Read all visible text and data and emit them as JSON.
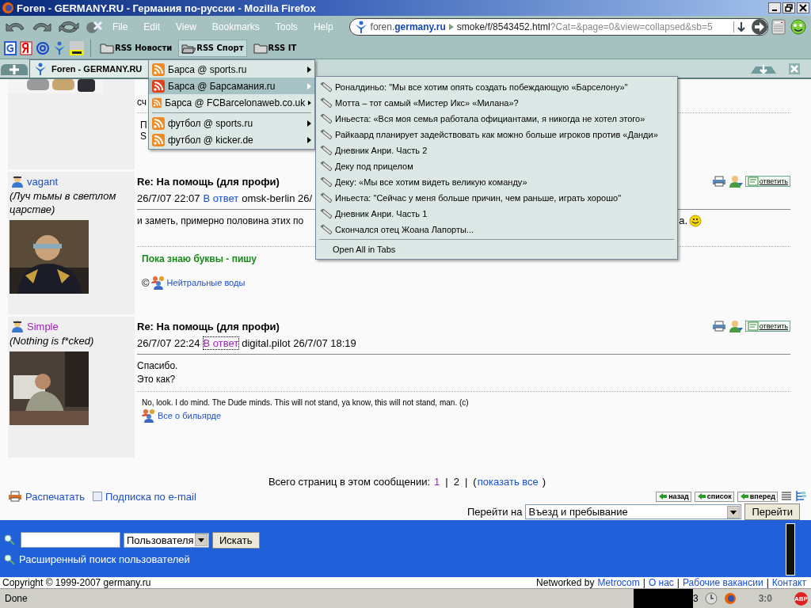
{
  "window": {
    "title": "Foren - GERMANY.RU - Германия по-русски - Mozilla Firefox"
  },
  "menu_bar": [
    "File",
    "Edit",
    "View",
    "Bookmarks",
    "Tools",
    "Help"
  ],
  "address": {
    "subdomain": "foren.",
    "domain": "germany.ru",
    "path": "smoke/f/8543452.html",
    "query": "?Cat=&page=0&view=collapsed&sb=5"
  },
  "bookmarks": [
    {
      "label": "RSS Новости",
      "selected": false
    },
    {
      "label": "RSS Спорт",
      "selected": true
    },
    {
      "label": "RSS IT",
      "selected": false
    }
  ],
  "tab": {
    "title": "Foren - GERMANY.RU"
  },
  "rss_menu": {
    "groups": [
      [
        {
          "label": "Барса @ sports.ru",
          "selected": false
        },
        {
          "label": "Барса @ Барсамания.ru",
          "selected": true
        },
        {
          "label": "Барса @ FCBarcelonaweb.co.uk",
          "selected": false
        }
      ],
      [
        {
          "label": "футбол @ sports.ru",
          "selected": false
        },
        {
          "label": "футбол @ kicker.de",
          "selected": false
        }
      ]
    ]
  },
  "feed_menu": {
    "items": [
      "Роналдиньо: \"Мы все хотим опять создать побеждающую «Барселону»\"",
      "Мотта – тот самый «Мистер Икс» «Милана»?",
      "Иньеста: «Вся моя семья работала официантами, я никогда не хотел этого»",
      "Райкаард планирует задействовать как можно больше игроков против «Данди»",
      "Дневник Анри. Часть 2",
      "Деку под прицелом",
      "Деку: «Мы все хотим видеть великую команду»",
      "Иньеста: \"Сейчас у меня больше причин, чем раньше, играть хорошо\"",
      "Дневник Анри. Часть 1",
      "Скончался отец Жоана Лапорты..."
    ],
    "open_all": "Open All in Tabs"
  },
  "previous_post": {
    "lines": [
      "сч",
      "П",
      "S"
    ]
  },
  "posts": [
    {
      "author": "vagant",
      "author_visited": false,
      "tagline": "(Луч тьмы в светлом царстве)",
      "title": "Re: На помощь (для профи)",
      "date": "26/7/07 22:07",
      "reply_link": "В ответ",
      "reply_visited": false,
      "reply_focused": false,
      "reply_to": "omsk-berlin 26/",
      "body": [
        "и заметь, примерно половина этих по"
      ],
      "body_tail": "а.",
      "smiley": true,
      "reply_button": "ответить",
      "signature": {
        "kind": "motto",
        "text": "Пока знаю буквы - пишу",
        "prefix": "©",
        "link": "Нейтральные воды"
      }
    },
    {
      "author": "Simple",
      "author_visited": true,
      "tagline": "(Nothing is f*cked)",
      "title": "Re: На помощь (для профи)",
      "date": "26/7/07 22:24",
      "reply_link": "В ответ",
      "reply_visited": true,
      "reply_focused": true,
      "reply_to": "digital.pilot 26/7/07 18:19",
      "body": [
        "Спасибо.",
        "Это как?"
      ],
      "smiley": false,
      "reply_button": "ответить",
      "signature": {
        "kind": "quote",
        "text": "No, look. I do mind. The Dude minds. This will not stand, ya know, this will not stand, man. (c)",
        "link": "Все о бильярде"
      }
    }
  ],
  "pager": {
    "label": "Всего страниц в этом сообщении:",
    "separator": "|",
    "open": "(",
    "close": ")",
    "pages": [
      {
        "label": "1",
        "current": false
      },
      {
        "label": "2",
        "current": true
      }
    ],
    "show_all": "показать все"
  },
  "page_actions": {
    "print": "Распечатать",
    "subscribe": "Подписка по e-mail"
  },
  "nav_buttons": [
    "назад",
    "список",
    "вперед"
  ],
  "jump": {
    "label": "Перейти на",
    "value": "Въезд и пребывание",
    "button": "Перейти"
  },
  "user_search": {
    "scope": "Пользователя",
    "button": "Искать",
    "advanced": "Расширенный поиск пользователей"
  },
  "copyright": "Copyright © 1999-2007 germany.ru",
  "credits": {
    "prefix": "Networked by",
    "separator": "|",
    "links": [
      "Metrocom",
      "О нас",
      "Рабочие вакансии",
      "Контакт"
    ]
  },
  "status_bar": {
    "text": "Done",
    "count": "3",
    "score": "3:0",
    "adblock": "ABP"
  }
}
